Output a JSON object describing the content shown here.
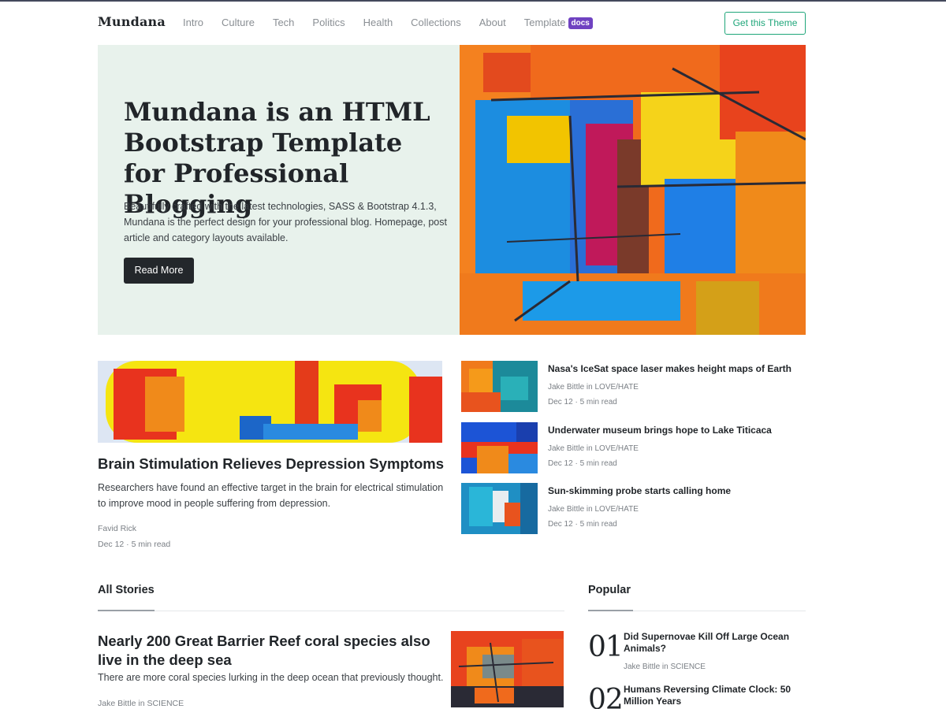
{
  "nav": {
    "brand": "Mundana",
    "links": [
      "Intro",
      "Culture",
      "Tech",
      "Politics",
      "Health",
      "Collections",
      "About"
    ],
    "template_label": "Template",
    "template_badge": "docs",
    "cta": "Get this Theme"
  },
  "hero": {
    "title": "Mundana is an HTML Bootstrap Template for Professional Blogging",
    "text": "Beautifully crafted with the latest technologies, SASS & Bootstrap 4.1.3, Mundana is the perfect design for your professional blog. Homepage, post article and category layouts available.",
    "button": "Read More"
  },
  "featured": {
    "title": "Brain Stimulation Relieves Depression Symptoms",
    "text": "Researchers have found an effective target in the brain for electrical stimulation to improve mood in people suffering from depression.",
    "author": "Favid Rick",
    "meta": "Dec 12 · 5 min read"
  },
  "side_articles": [
    {
      "title": "Nasa's IceSat space laser makes height maps of Earth",
      "author": "Jake Bittle in LOVE/HATE",
      "meta": "Dec 12 · 5 min read"
    },
    {
      "title": "Underwater museum brings hope to Lake Titicaca",
      "author": "Jake Bittle in LOVE/HATE",
      "meta": "Dec 12 · 5 min read"
    },
    {
      "title": "Sun-skimming probe starts calling home",
      "author": "Jake Bittle in LOVE/HATE",
      "meta": "Dec 12 · 5 min read"
    }
  ],
  "all_stories": {
    "heading": "All Stories",
    "story": {
      "title": "Nearly 200 Great Barrier Reef coral species also live in the deep sea",
      "text": "There are more coral species lurking in the deep ocean that previously thought.",
      "author": "Jake Bittle in SCIENCE"
    }
  },
  "popular": {
    "heading": "Popular",
    "items": [
      {
        "num": "01",
        "title": "Did Supernovae Kill Off Large Ocean Animals?",
        "author": "Jake Bittle in SCIENCE"
      },
      {
        "num": "02",
        "title": "Humans Reversing Climate Clock: 50 Million Years",
        "author": ""
      }
    ]
  },
  "colors": {
    "accent": "#1fa67a",
    "badge": "#6f42c1",
    "hero_bg": "#e8f2ec",
    "dark_button": "#23272b"
  }
}
